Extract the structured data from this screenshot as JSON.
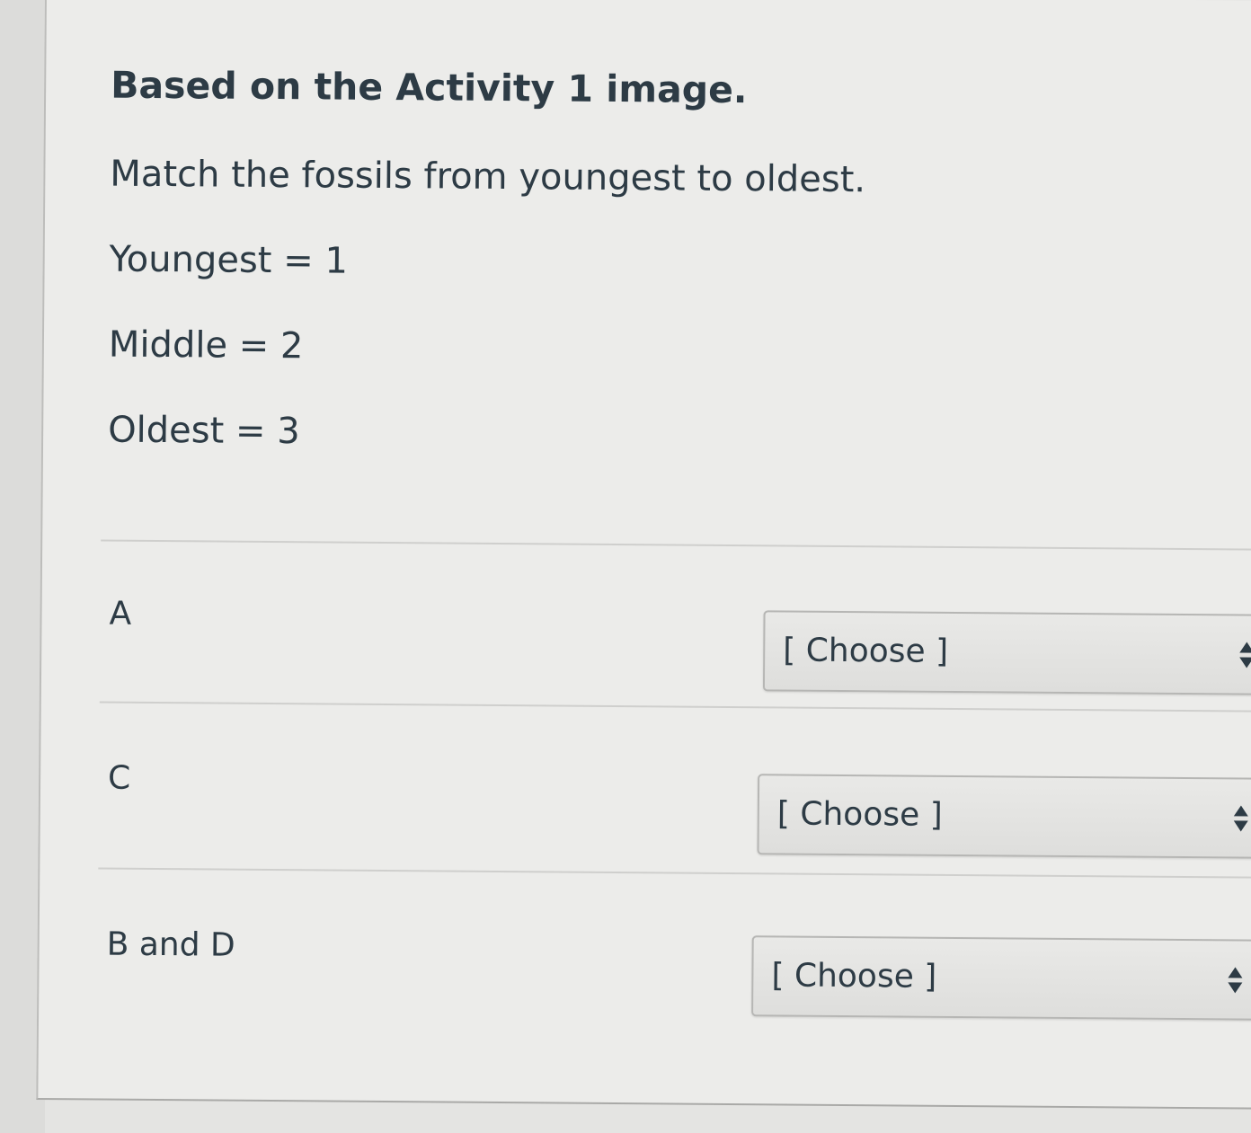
{
  "question": {
    "title": "Based on the Activity 1 image.",
    "instruction": "Match the fossils from youngest to oldest.",
    "legend": [
      "Youngest = 1",
      "Middle = 2",
      "Oldest = 3"
    ]
  },
  "matches": [
    {
      "label": "A",
      "selected": "[ Choose ]"
    },
    {
      "label": "C",
      "selected": "[ Choose ]"
    },
    {
      "label": "B and D",
      "selected": "[ Choose ]"
    }
  ],
  "icons": {
    "select_arrow": "up-down-arrows-icon"
  },
  "colors": {
    "text": "#2d3b45",
    "background": "#ececea"
  }
}
